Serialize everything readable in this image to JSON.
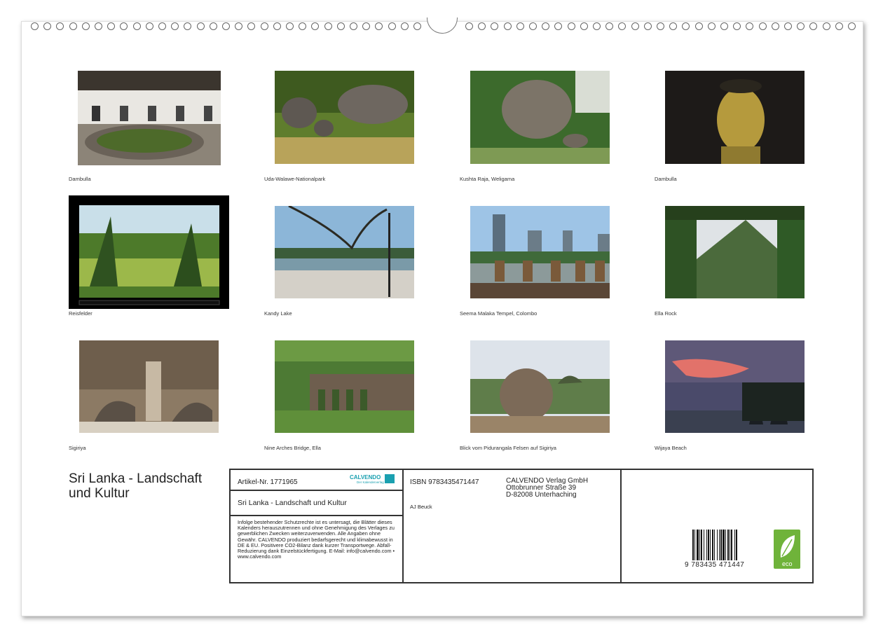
{
  "photos": [
    {
      "caption": "Dambulla"
    },
    {
      "caption": "Uda-Walawe-Nationalpark"
    },
    {
      "caption": "Kushta Raja, Weligama"
    },
    {
      "caption": "Dambulla"
    },
    {
      "caption": "Reisfelder"
    },
    {
      "caption": "Kandy Lake"
    },
    {
      "caption": "Seema Malaka Tempel, Colombo"
    },
    {
      "caption": "Ella Rock"
    },
    {
      "caption": "Sigiriya"
    },
    {
      "caption": "Nine Arches Bridge, Ella"
    },
    {
      "caption": "Blick vom Pidurangala Felsen auf Sigiriya"
    },
    {
      "caption": "Wijaya Beach"
    }
  ],
  "title": "Sri Lanka - Landschaft und Kultur",
  "info": {
    "article": "Artikel-Nr. 1771965",
    "brand": "CALVENDO",
    "brand_sub": "Der Kalenderverlag",
    "subtitle": "Sri Lanka - Landschaft und Kultur",
    "legal": "Infolge bestehender Schutzrechte ist es untersagt, die Blätter dieses Kalenders herauszutrennen und ohne Genehmigung des Verlages zu gewerblichen Zwecken weiterzuverwenden. Alle Angaben ohne Gewähr. CALVENDO produziert bedarfsgerecht und klimabewusst in DE & EU. Positivere CO2-Bilanz dank kurzer Transportwege. Abfall-Reduzierung dank Einzelstückfertigung. E-Mail: info@calvendo.com • www.calvendo.com",
    "isbn": "ISBN 9783435471447",
    "author": "AJ Beuck",
    "publisher_name": "CALVENDO Verlag GmbH",
    "publisher_street": "Ottobrunner Straße 39",
    "publisher_city": "D-82008 Unterhaching",
    "barcode_digits": "9  783435  471447",
    "eco_label": "eco"
  },
  "colors": {
    "border": "#333333",
    "eco_green": "#6fb33a",
    "brand_teal": "#1aa0b0"
  }
}
